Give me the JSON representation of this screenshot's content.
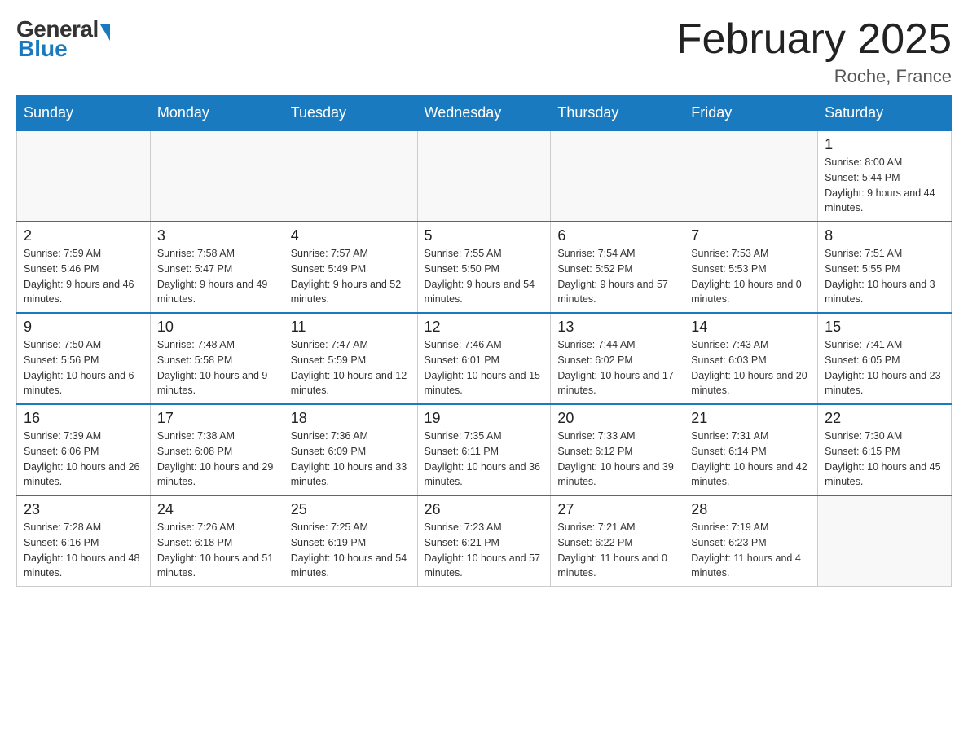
{
  "logo": {
    "general": "General",
    "blue": "Blue"
  },
  "title": "February 2025",
  "location": "Roche, France",
  "days_of_week": [
    "Sunday",
    "Monday",
    "Tuesday",
    "Wednesday",
    "Thursday",
    "Friday",
    "Saturday"
  ],
  "weeks": [
    [
      {
        "day": "",
        "info": ""
      },
      {
        "day": "",
        "info": ""
      },
      {
        "day": "",
        "info": ""
      },
      {
        "day": "",
        "info": ""
      },
      {
        "day": "",
        "info": ""
      },
      {
        "day": "",
        "info": ""
      },
      {
        "day": "1",
        "info": "Sunrise: 8:00 AM\nSunset: 5:44 PM\nDaylight: 9 hours and 44 minutes."
      }
    ],
    [
      {
        "day": "2",
        "info": "Sunrise: 7:59 AM\nSunset: 5:46 PM\nDaylight: 9 hours and 46 minutes."
      },
      {
        "day": "3",
        "info": "Sunrise: 7:58 AM\nSunset: 5:47 PM\nDaylight: 9 hours and 49 minutes."
      },
      {
        "day": "4",
        "info": "Sunrise: 7:57 AM\nSunset: 5:49 PM\nDaylight: 9 hours and 52 minutes."
      },
      {
        "day": "5",
        "info": "Sunrise: 7:55 AM\nSunset: 5:50 PM\nDaylight: 9 hours and 54 minutes."
      },
      {
        "day": "6",
        "info": "Sunrise: 7:54 AM\nSunset: 5:52 PM\nDaylight: 9 hours and 57 minutes."
      },
      {
        "day": "7",
        "info": "Sunrise: 7:53 AM\nSunset: 5:53 PM\nDaylight: 10 hours and 0 minutes."
      },
      {
        "day": "8",
        "info": "Sunrise: 7:51 AM\nSunset: 5:55 PM\nDaylight: 10 hours and 3 minutes."
      }
    ],
    [
      {
        "day": "9",
        "info": "Sunrise: 7:50 AM\nSunset: 5:56 PM\nDaylight: 10 hours and 6 minutes."
      },
      {
        "day": "10",
        "info": "Sunrise: 7:48 AM\nSunset: 5:58 PM\nDaylight: 10 hours and 9 minutes."
      },
      {
        "day": "11",
        "info": "Sunrise: 7:47 AM\nSunset: 5:59 PM\nDaylight: 10 hours and 12 minutes."
      },
      {
        "day": "12",
        "info": "Sunrise: 7:46 AM\nSunset: 6:01 PM\nDaylight: 10 hours and 15 minutes."
      },
      {
        "day": "13",
        "info": "Sunrise: 7:44 AM\nSunset: 6:02 PM\nDaylight: 10 hours and 17 minutes."
      },
      {
        "day": "14",
        "info": "Sunrise: 7:43 AM\nSunset: 6:03 PM\nDaylight: 10 hours and 20 minutes."
      },
      {
        "day": "15",
        "info": "Sunrise: 7:41 AM\nSunset: 6:05 PM\nDaylight: 10 hours and 23 minutes."
      }
    ],
    [
      {
        "day": "16",
        "info": "Sunrise: 7:39 AM\nSunset: 6:06 PM\nDaylight: 10 hours and 26 minutes."
      },
      {
        "day": "17",
        "info": "Sunrise: 7:38 AM\nSunset: 6:08 PM\nDaylight: 10 hours and 29 minutes."
      },
      {
        "day": "18",
        "info": "Sunrise: 7:36 AM\nSunset: 6:09 PM\nDaylight: 10 hours and 33 minutes."
      },
      {
        "day": "19",
        "info": "Sunrise: 7:35 AM\nSunset: 6:11 PM\nDaylight: 10 hours and 36 minutes."
      },
      {
        "day": "20",
        "info": "Sunrise: 7:33 AM\nSunset: 6:12 PM\nDaylight: 10 hours and 39 minutes."
      },
      {
        "day": "21",
        "info": "Sunrise: 7:31 AM\nSunset: 6:14 PM\nDaylight: 10 hours and 42 minutes."
      },
      {
        "day": "22",
        "info": "Sunrise: 7:30 AM\nSunset: 6:15 PM\nDaylight: 10 hours and 45 minutes."
      }
    ],
    [
      {
        "day": "23",
        "info": "Sunrise: 7:28 AM\nSunset: 6:16 PM\nDaylight: 10 hours and 48 minutes."
      },
      {
        "day": "24",
        "info": "Sunrise: 7:26 AM\nSunset: 6:18 PM\nDaylight: 10 hours and 51 minutes."
      },
      {
        "day": "25",
        "info": "Sunrise: 7:25 AM\nSunset: 6:19 PM\nDaylight: 10 hours and 54 minutes."
      },
      {
        "day": "26",
        "info": "Sunrise: 7:23 AM\nSunset: 6:21 PM\nDaylight: 10 hours and 57 minutes."
      },
      {
        "day": "27",
        "info": "Sunrise: 7:21 AM\nSunset: 6:22 PM\nDaylight: 11 hours and 0 minutes."
      },
      {
        "day": "28",
        "info": "Sunrise: 7:19 AM\nSunset: 6:23 PM\nDaylight: 11 hours and 4 minutes."
      },
      {
        "day": "",
        "info": ""
      }
    ]
  ]
}
